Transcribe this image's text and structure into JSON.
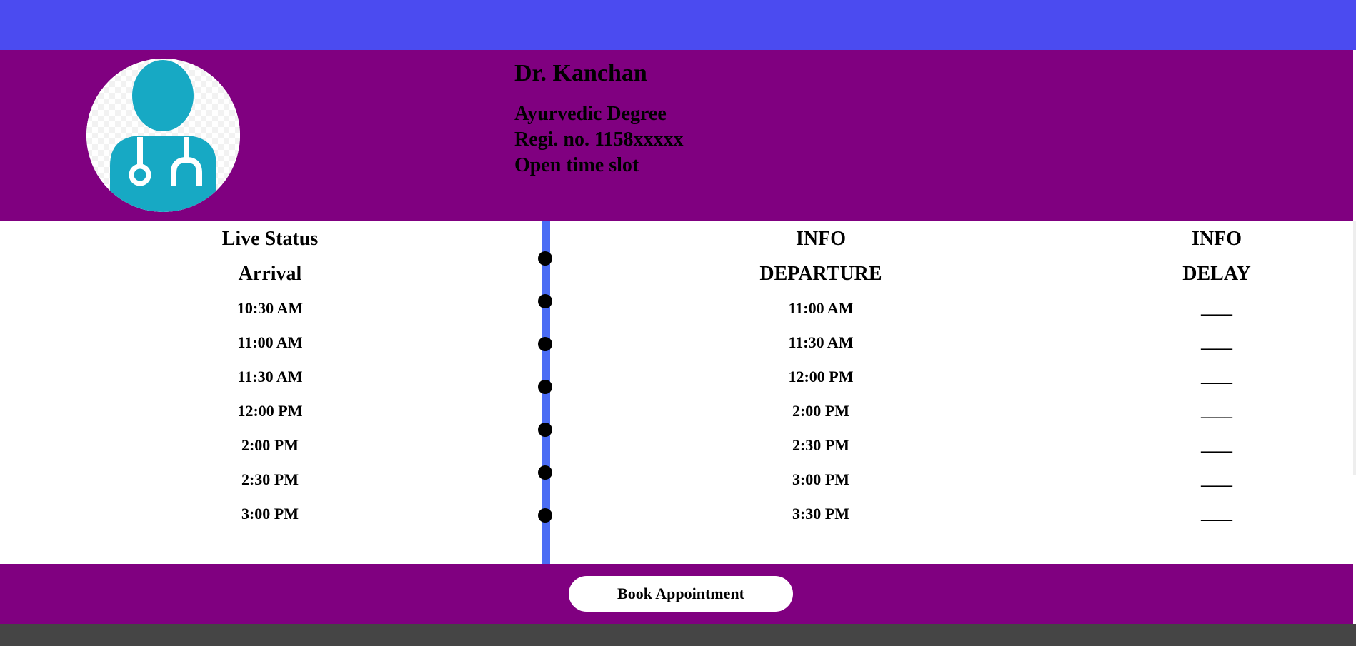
{
  "colors": {
    "topbar": "#4b4bf0",
    "header": "#800080",
    "timeline": "#4a6cf4",
    "avatar_figure": "#17a9c4",
    "footer": "#454545"
  },
  "doctor": {
    "avatar_icon": "doctor-icon",
    "name": "Dr. Kanchan",
    "degree": "Ayurvedic Degree",
    "registration": "Regi. no. 1158xxxxx",
    "slot_label": "Open time slot"
  },
  "schedule": {
    "arrival": {
      "header": "Live Status",
      "subheader": "Arrival",
      "times": [
        "10:30 AM",
        "11:00 AM",
        "11:30 AM",
        "12:00 PM",
        "2:00 PM",
        "2:30 PM",
        "3:00 PM"
      ]
    },
    "departure": {
      "header": "INFO",
      "subheader": "DEPARTURE",
      "times": [
        "11:00 AM",
        "11:30 AM",
        "12:00 PM",
        "2:00 PM",
        "2:30 PM",
        "3:00 PM",
        "3:30 PM"
      ]
    },
    "delay": {
      "header": "INFO",
      "subheader": "DELAY",
      "values": [
        "____",
        "____",
        "____",
        "____",
        "____",
        "____",
        "____"
      ]
    }
  },
  "footer": {
    "book_label": "Book Appointment"
  }
}
